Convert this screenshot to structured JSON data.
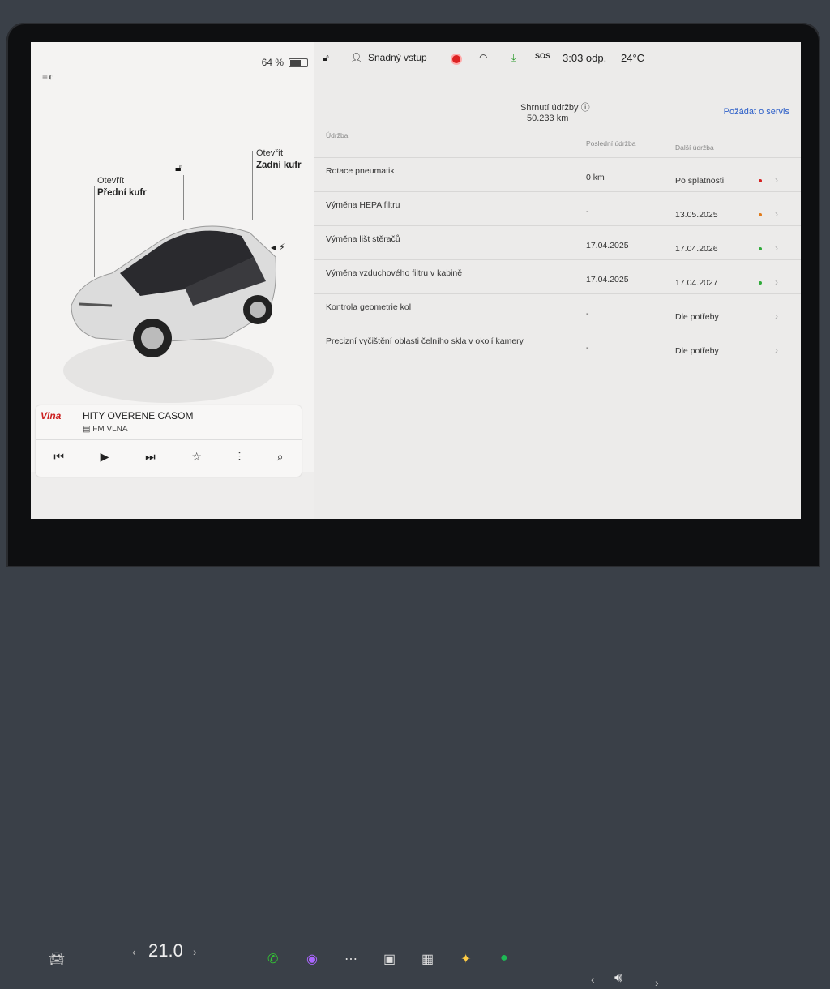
{
  "battery": {
    "percent": "64 %",
    "fill": 0.64
  },
  "left": {
    "front_trunk": {
      "action": "Otevřít",
      "name": "Přední kufr"
    },
    "rear_trunk": {
      "action": "Otevřít",
      "name": "Zadní kufr"
    }
  },
  "media": {
    "logo": "Vlna",
    "song": "HITY OVERENE CASOM",
    "station": "FM VLNA"
  },
  "status": {
    "profile": "Snadný vstup",
    "sos": "SOS",
    "time": "3:03 odp.",
    "temp": "24°C"
  },
  "summary": {
    "title": "Shrnutí údržby",
    "km": "50.233 km",
    "service_link": "Požádat o servis"
  },
  "table": {
    "col_item": "Údržba",
    "col_last": "Poslední údržba",
    "col_next": "Další údržba",
    "rows": [
      {
        "name": "Rotace pneumatik",
        "last": "0 km",
        "next": "Po splatnosti",
        "dot": "#d42020"
      },
      {
        "name": "Výměna HEPA filtru",
        "last": "-",
        "next": "13.05.2025",
        "dot": "#e07a1a"
      },
      {
        "name": "Výměna lišt stěračů",
        "last": "17.04.2025",
        "next": "17.04.2026",
        "dot": "#2faa3a"
      },
      {
        "name": "Výměna vzduchového filtru v kabině",
        "last": "17.04.2025",
        "next": "17.04.2027",
        "dot": "#2faa3a"
      },
      {
        "name": "Kontrola geometrie kol",
        "last": "-",
        "next": "Dle potřeby",
        "dot": ""
      },
      {
        "name": "Precizní vyčištění oblasti čelního skla v okolí kamery",
        "last": "-",
        "next": "Dle potřeby",
        "dot": ""
      }
    ]
  },
  "dock": {
    "cabin_temp": "21.0"
  }
}
